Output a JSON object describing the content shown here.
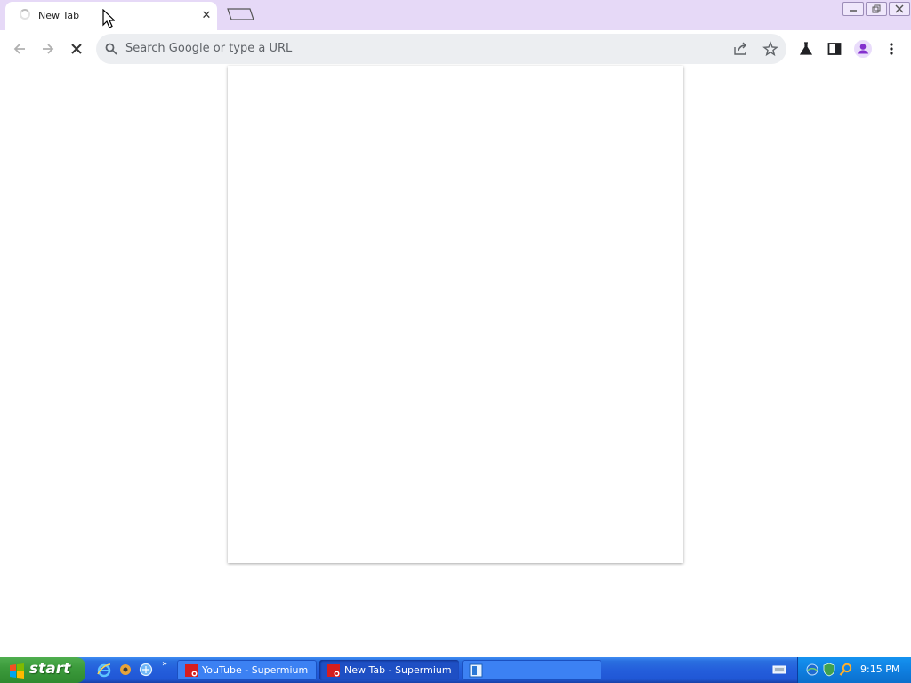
{
  "browser": {
    "tab": {
      "title": "New Tab"
    },
    "omnibox": {
      "placeholder": "Search Google or type a URL"
    }
  },
  "taskbar": {
    "start_label": "start",
    "tasks": [
      {
        "label": "YouTube - Supermium"
      },
      {
        "label": "New Tab - Supermium"
      },
      {
        "label": ""
      }
    ],
    "clock": "9:15 PM"
  },
  "colors": {
    "tabstrip": "#e6d9f7",
    "profile_accent": "#8430ce",
    "taskbar_blue": "#245edb",
    "start_green": "#3c9b3c"
  },
  "icons": [
    "back-arrow-icon",
    "forward-arrow-icon",
    "stop-icon",
    "search-icon",
    "share-icon",
    "star-icon",
    "labs-flask-icon",
    "side-panel-icon",
    "profile-icon",
    "menu-kebab-icon"
  ]
}
